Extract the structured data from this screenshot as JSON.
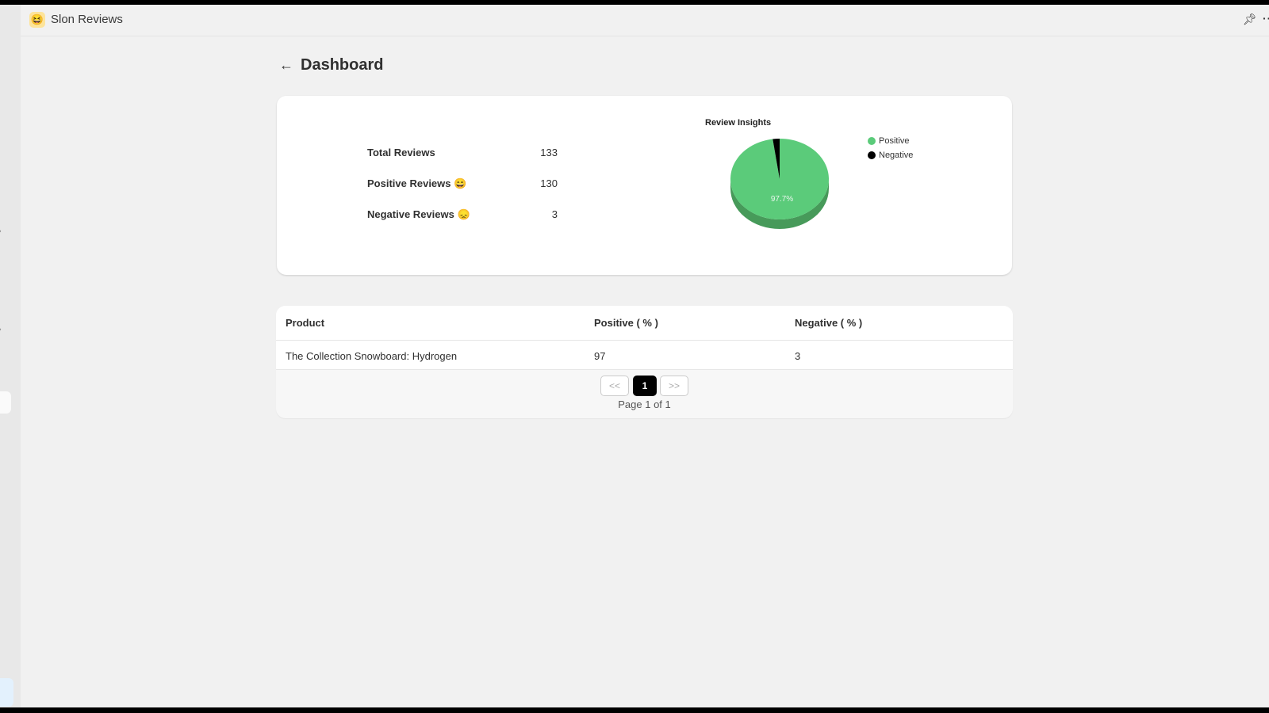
{
  "app": {
    "title": "Slon Reviews",
    "icon": "grinning-face-icon"
  },
  "page": {
    "title": "Dashboard"
  },
  "stats": [
    {
      "label": "Total Reviews",
      "emoji": "",
      "value": "133"
    },
    {
      "label": "Positive Reviews",
      "emoji": "😄",
      "value": "130"
    },
    {
      "label": "Negative Reviews",
      "emoji": "😞",
      "value": "3"
    }
  ],
  "chart_data": {
    "type": "pie",
    "title": "Review Insights",
    "categories": [
      "Positive",
      "Negative"
    ],
    "values": [
      130,
      3
    ],
    "colors": [
      "#5bcb7a",
      "#000000"
    ],
    "data_labels": [
      "97.7%",
      ""
    ],
    "legend_position": "right",
    "style": "3d"
  },
  "table": {
    "headers": [
      "Product",
      "Positive ( % )",
      "Negative ( % )"
    ],
    "rows": [
      [
        "The Collection Snowboard: Hydrogen",
        "97",
        "3"
      ]
    ]
  },
  "pagination": {
    "prev": "<<",
    "current": "1",
    "next": ">>",
    "info": "Page 1 of 1"
  }
}
